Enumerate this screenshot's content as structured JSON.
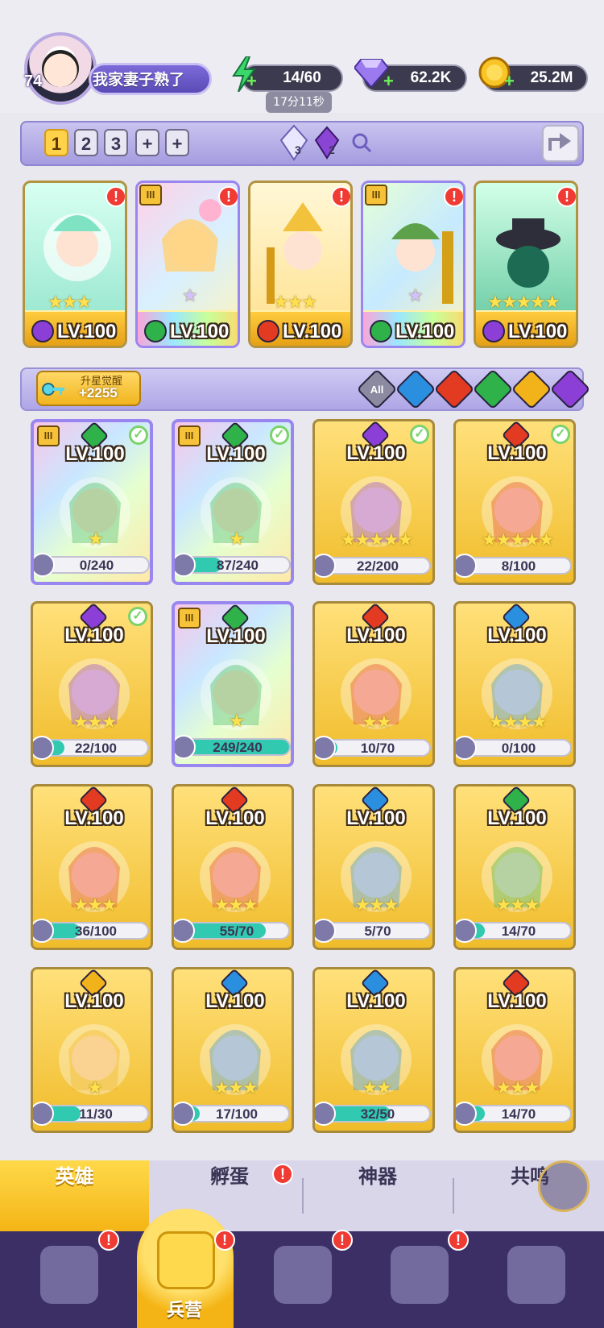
{
  "player": {
    "level": "74",
    "name": "我家妻子熟了",
    "energy": "14/60",
    "energy_timer": "17分11秒",
    "gems": "62.2K",
    "coins": "25.2M"
  },
  "team_bar": {
    "slots": [
      "1",
      "2",
      "3",
      "+",
      "+"
    ],
    "active_slot": "1",
    "crystal_a_count": "3",
    "crystal_b_count": "2"
  },
  "team_heroes": [
    {
      "level": "LV.100",
      "stars": "★★★",
      "element": "dark",
      "alert": "!"
    },
    {
      "level": "LV.100",
      "stars": "★",
      "element": "wind",
      "alert": "!"
    },
    {
      "level": "LV.100",
      "stars": "★★★",
      "element": "fire",
      "alert": "!"
    },
    {
      "level": "LV.100",
      "stars": "★",
      "element": "wind",
      "alert": "!"
    },
    {
      "level": "LV.100",
      "stars": "★★★★★",
      "element": "dark",
      "alert": "!"
    }
  ],
  "awaken": {
    "title": "升星觉醒",
    "value": "+2255"
  },
  "filters": {
    "all_label": "All",
    "elements": [
      "water",
      "fire",
      "wind",
      "light",
      "dark"
    ]
  },
  "heroes": [
    {
      "level": "LV.100",
      "progress": "0/240",
      "fill": 0.0,
      "rainbow": true,
      "check": true,
      "tier": true,
      "element": "wind",
      "stars": "★"
    },
    {
      "level": "LV.100",
      "progress": "87/240",
      "fill": 0.36,
      "rainbow": true,
      "check": true,
      "tier": true,
      "element": "wind",
      "stars": "★"
    },
    {
      "level": "LV.100",
      "progress": "22/200",
      "fill": 0.11,
      "rainbow": false,
      "check": true,
      "tier": false,
      "element": "dark",
      "stars": "★★★★★"
    },
    {
      "level": "LV.100",
      "progress": "8/100",
      "fill": 0.08,
      "rainbow": false,
      "check": true,
      "tier": false,
      "element": "fire",
      "stars": "★★★★★"
    },
    {
      "level": "LV.100",
      "progress": "22/100",
      "fill": 0.22,
      "rainbow": false,
      "check": true,
      "tier": false,
      "element": "dark",
      "stars": "★★★"
    },
    {
      "level": "LV.100",
      "progress": "249/240",
      "fill": 1.0,
      "rainbow": true,
      "check": false,
      "tier": true,
      "element": "wind",
      "stars": "★"
    },
    {
      "level": "LV.100",
      "progress": "10/70",
      "fill": 0.14,
      "rainbow": false,
      "check": false,
      "tier": false,
      "element": "fire",
      "stars": "★★"
    },
    {
      "level": "LV.100",
      "progress": "0/100",
      "fill": 0.0,
      "rainbow": false,
      "check": false,
      "tier": false,
      "element": "water",
      "stars": "★★★★"
    },
    {
      "level": "LV.100",
      "progress": "36/100",
      "fill": 0.36,
      "rainbow": false,
      "check": false,
      "tier": false,
      "element": "fire",
      "stars": "★★★"
    },
    {
      "level": "LV.100",
      "progress": "55/70",
      "fill": 0.79,
      "rainbow": false,
      "check": false,
      "tier": false,
      "element": "fire",
      "stars": "★★★"
    },
    {
      "level": "LV.100",
      "progress": "5/70",
      "fill": 0.07,
      "rainbow": false,
      "check": false,
      "tier": false,
      "element": "water",
      "stars": "★★★"
    },
    {
      "level": "LV.100",
      "progress": "14/70",
      "fill": 0.2,
      "rainbow": false,
      "check": false,
      "tier": false,
      "element": "wind",
      "stars": "★★★"
    },
    {
      "level": "LV.100",
      "progress": "11/30",
      "fill": 0.37,
      "rainbow": false,
      "check": false,
      "tier": false,
      "element": "light",
      "stars": "★"
    },
    {
      "level": "LV.100",
      "progress": "17/100",
      "fill": 0.17,
      "rainbow": false,
      "check": false,
      "tier": false,
      "element": "water",
      "stars": "★★★"
    },
    {
      "level": "LV.100",
      "progress": "32/50",
      "fill": 0.64,
      "rainbow": false,
      "check": false,
      "tier": false,
      "element": "water",
      "stars": "★★"
    },
    {
      "level": "LV.100",
      "progress": "14/70",
      "fill": 0.2,
      "rainbow": false,
      "check": false,
      "tier": false,
      "element": "fire",
      "stars": "★★★"
    }
  ],
  "tabs": [
    {
      "label": "英雄",
      "active": true,
      "alert": ""
    },
    {
      "label": "孵蛋",
      "active": false,
      "alert": "!"
    },
    {
      "label": "神器",
      "active": false,
      "alert": ""
    },
    {
      "label": "共鸣",
      "active": false,
      "alert": ""
    }
  ],
  "bottom_nav": [
    {
      "icon": "cards-icon",
      "label": "",
      "active": false,
      "alert": "!"
    },
    {
      "icon": "barracks-icon",
      "label": "兵营",
      "active": true,
      "alert": "!"
    },
    {
      "icon": "map-icon",
      "label": "",
      "active": false,
      "alert": "!"
    },
    {
      "icon": "shop-icon",
      "label": "",
      "active": false,
      "alert": "!"
    },
    {
      "icon": "guild-icon",
      "label": "",
      "active": false,
      "alert": ""
    }
  ],
  "colors": {
    "accent_gold": "#f4b516",
    "accent_purple": "#7c6ad9",
    "nav_bg": "#3b2f66",
    "progress_fill": "#31c9b0",
    "alert_red": "#ef3b33",
    "element_water": "#2b8fe0",
    "element_fire": "#e33a22",
    "element_wind": "#2fb24a",
    "element_light": "#f2b21a",
    "element_dark": "#8c3fd6"
  }
}
